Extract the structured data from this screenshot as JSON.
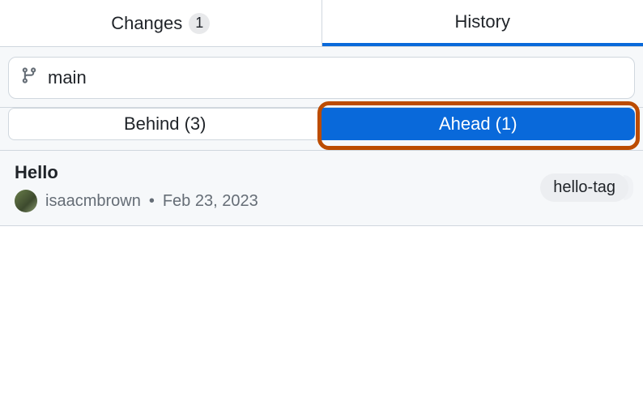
{
  "tabs": {
    "changes_label": "Changes",
    "changes_count": "1",
    "history_label": "History"
  },
  "branch": {
    "name": "main"
  },
  "segmented": {
    "behind_label": "Behind (3)",
    "ahead_label": "Ahead (1)"
  },
  "commits": [
    {
      "title": "Hello",
      "author": "isaacmbrown",
      "separator": "•",
      "date": "Feb 23, 2023",
      "tag": "hello-tag"
    }
  ],
  "colors": {
    "accent": "#0969da",
    "highlight": "#bc4c00"
  }
}
